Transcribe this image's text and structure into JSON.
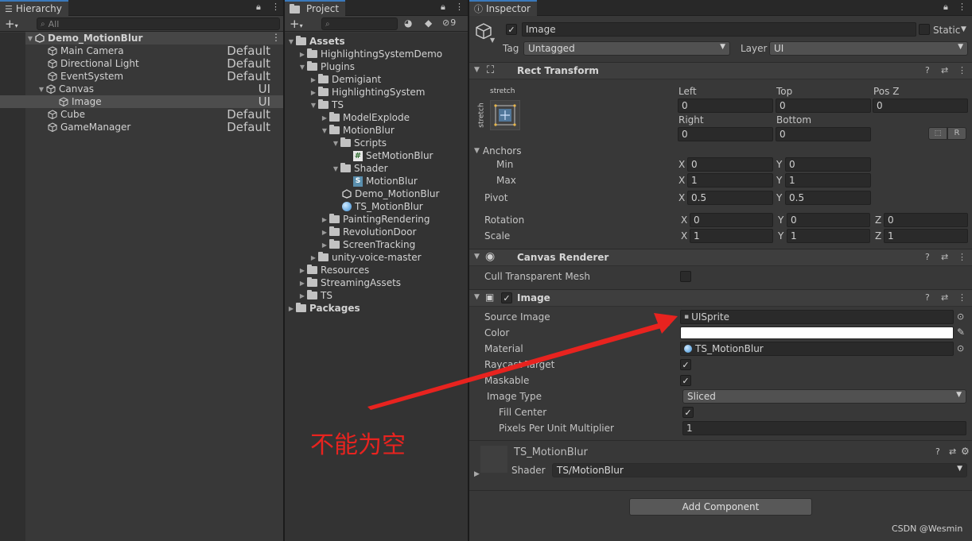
{
  "hierarchy": {
    "tab_label": "Hierarchy",
    "search_placeholder": "All",
    "scene_name": "Demo_MotionBlur",
    "items": [
      {
        "label": "Main Camera",
        "layer": "Default"
      },
      {
        "label": "Directional Light",
        "layer": "Default"
      },
      {
        "label": "EventSystem",
        "layer": "Default"
      },
      {
        "label": "Canvas",
        "layer": "UI"
      },
      {
        "label": "Image",
        "layer": "UI"
      },
      {
        "label": "Cube",
        "layer": "Default"
      },
      {
        "label": "GameManager",
        "layer": "Default"
      }
    ]
  },
  "project": {
    "tab_label": "Project",
    "hidden_count": "9",
    "tree": [
      {
        "label": "Assets",
        "bold": true
      },
      {
        "label": "HighlightingSystemDemo"
      },
      {
        "label": "Plugins"
      },
      {
        "label": "Demigiant"
      },
      {
        "label": "HighlightingSystem"
      },
      {
        "label": "TS"
      },
      {
        "label": "ModelExplode"
      },
      {
        "label": "MotionBlur"
      },
      {
        "label": "Scripts"
      },
      {
        "label": "SetMotionBlur"
      },
      {
        "label": "Shader"
      },
      {
        "label": "MotionBlur"
      },
      {
        "label": "Demo_MotionBlur"
      },
      {
        "label": "TS_MotionBlur"
      },
      {
        "label": "PaintingRendering"
      },
      {
        "label": "RevolutionDoor"
      },
      {
        "label": "ScreenTracking"
      },
      {
        "label": "unity-voice-master"
      },
      {
        "label": "Resources"
      },
      {
        "label": "StreamingAssets"
      },
      {
        "label": "TS"
      },
      {
        "label": "Packages",
        "bold": true
      }
    ]
  },
  "inspector": {
    "tab_label": "Inspector",
    "object_name": "Image",
    "static_label": "Static",
    "tag_label": "Tag",
    "tag_value": "Untagged",
    "layer_label": "Layer",
    "layer_value": "UI",
    "rect_transform": {
      "title": "Rect Transform",
      "stretch_h": "stretch",
      "stretch_v": "stretch",
      "left_label": "Left",
      "left": "0",
      "top_label": "Top",
      "top": "0",
      "posz_label": "Pos Z",
      "posz": "0",
      "right_label": "Right",
      "right": "0",
      "bottom_label": "Bottom",
      "bottom": "0",
      "r_button": "R",
      "anchors_label": "Anchors",
      "min_label": "Min",
      "min_x": "0",
      "min_y": "0",
      "max_label": "Max",
      "max_x": "1",
      "max_y": "1",
      "pivot_label": "Pivot",
      "pivot_x": "0.5",
      "pivot_y": "0.5",
      "rotation_label": "Rotation",
      "rot_x": "0",
      "rot_y": "0",
      "rot_z": "0",
      "scale_label": "Scale",
      "scale_x": "1",
      "scale_y": "1",
      "scale_z": "1",
      "x": "X",
      "y": "Y",
      "z": "Z"
    },
    "canvas_renderer": {
      "title": "Canvas Renderer",
      "cull_label": "Cull Transparent Mesh"
    },
    "image": {
      "title": "Image",
      "source_label": "Source Image",
      "source_value": "UISprite",
      "color_label": "Color",
      "material_label": "Material",
      "material_value": "TS_MotionBlur",
      "raycast_label": "Raycast Target",
      "maskable_label": "Maskable",
      "type_label": "Image Type",
      "type_value": "Sliced",
      "fill_label": "Fill Center",
      "ppu_label": "Pixels Per Unit Multiplier",
      "ppu_value": "1"
    },
    "material": {
      "name": "TS_MotionBlur",
      "shader_label": "Shader",
      "shader_value": "TS/MotionBlur"
    },
    "add_component": "Add Component"
  },
  "annotation": {
    "text": "不能为空",
    "color": "#e8231f"
  },
  "watermark": "CSDN @Wesmin",
  "colors": {
    "selection": "#4d4d4d",
    "accent": "#3a79bb"
  }
}
